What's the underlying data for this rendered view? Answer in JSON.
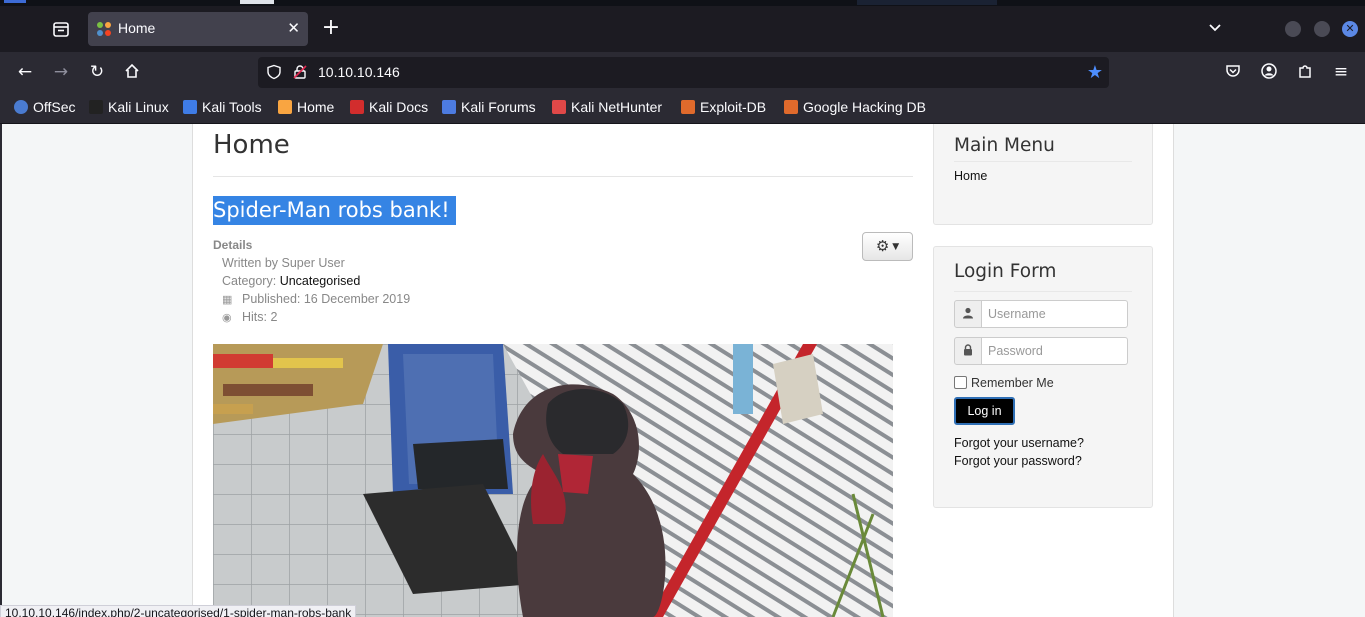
{
  "browser": {
    "tab_title": "Home",
    "tab_close": "✕",
    "new_tab": "+",
    "url": "10.10.10.146",
    "bookmarks": [
      {
        "label": "OffSec",
        "icon": "offsec-icon",
        "color": "#4a7bd0"
      },
      {
        "label": "Kali Linux",
        "icon": "kali-dragon-icon",
        "color": "#222222"
      },
      {
        "label": "Kali Tools",
        "icon": "kali-tools-icon",
        "color": "#3f7ce6"
      },
      {
        "label": "Home",
        "icon": "joomla-icon",
        "color": "#f9a541"
      },
      {
        "label": "Kali Docs",
        "icon": "kali-docs-icon",
        "color": "#d22d2d"
      },
      {
        "label": "Kali Forums",
        "icon": "kali-forums-icon",
        "color": "#4d7be0"
      },
      {
        "label": "Kali NetHunter",
        "icon": "nethunter-icon",
        "color": "#e04848"
      },
      {
        "label": "Exploit-DB",
        "icon": "exploitdb-icon",
        "color": "#e06a2c"
      },
      {
        "label": "Google Hacking DB",
        "icon": "ghdb-icon",
        "color": "#e06a2c"
      }
    ],
    "status_url": "10.10.10.146/index.php/2-uncategorised/1-spider-man-robs-bank"
  },
  "main": {
    "page_heading": "Home",
    "article": {
      "title": "Spider-Man robs bank!",
      "details_label": "Details",
      "written_by": "Written by Super User",
      "category_label": "Category:",
      "category_value": "Uncategorised",
      "published": "Published: 16 December 2019",
      "hits": "Hits: 2"
    }
  },
  "sidebar": {
    "main_menu_title": "Main Menu",
    "main_menu_items": [
      "Home"
    ],
    "login_title": "Login Form",
    "username_placeholder": "Username",
    "password_placeholder": "Password",
    "remember_label": "Remember Me",
    "login_button": "Log in",
    "forgot_username": "Forgot your username?",
    "forgot_password": "Forgot your password?"
  },
  "colors": {
    "tab_bar": "#1c1b22",
    "toolbar": "#2b2a33",
    "selection": "#3584e4",
    "login_button": "#000000"
  }
}
